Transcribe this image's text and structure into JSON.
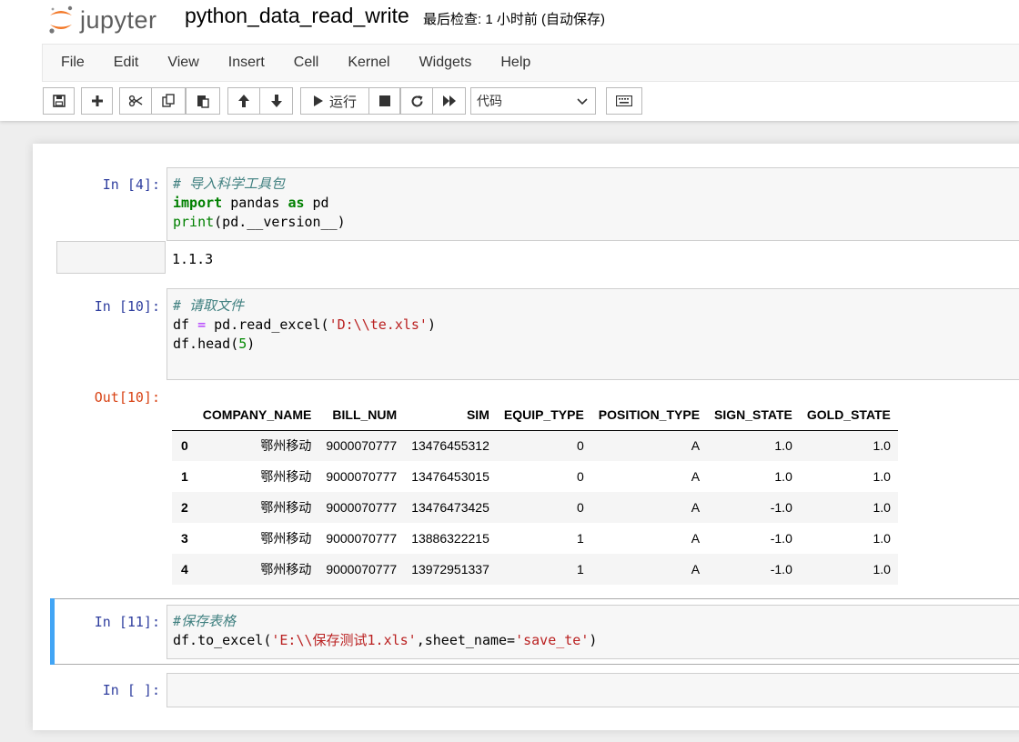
{
  "header": {
    "logo_text": "jupyter",
    "notebook_title": "python_data_read_write",
    "checkpoint": "最后检查: 1 小时前  (自动保存)"
  },
  "menu": [
    "File",
    "Edit",
    "View",
    "Insert",
    "Cell",
    "Kernel",
    "Widgets",
    "Help"
  ],
  "toolbar": {
    "run_label": "运行",
    "cell_type": "代码"
  },
  "cells": {
    "c1": {
      "prompt": "In  [4]:",
      "lines": [
        [
          {
            "t": "# 导入科学工具包",
            "c": "cm-comment"
          }
        ],
        [
          {
            "t": "import",
            "c": "cm-kw"
          },
          {
            "t": " pandas ",
            "c": ""
          },
          {
            "t": "as",
            "c": "cm-kw"
          },
          {
            "t": " pd",
            "c": ""
          }
        ],
        [
          {
            "t": "print",
            "c": "cm-builtin"
          },
          {
            "t": "(pd.__version__)",
            "c": ""
          }
        ]
      ],
      "output": "1.1.3"
    },
    "c2": {
      "prompt": "In  [10]:",
      "lines": [
        [
          {
            "t": "# 请取文件",
            "c": "cm-comment"
          }
        ],
        [
          {
            "t": "df ",
            "c": ""
          },
          {
            "t": "=",
            "c": "cm-op"
          },
          {
            "t": " pd.read_excel(",
            "c": ""
          },
          {
            "t": "'D:\\\\te.xls'",
            "c": "cm-str"
          },
          {
            "t": ")",
            "c": ""
          }
        ],
        [
          {
            "t": "df.head(",
            "c": ""
          },
          {
            "t": "5",
            "c": "cm-num"
          },
          {
            "t": ")",
            "c": ""
          }
        ]
      ],
      "out_prompt": "Out[10]:"
    },
    "c3": {
      "prompt": "In  [11]:",
      "lines": [
        [
          {
            "t": "#保存表格",
            "c": "cm-comment"
          }
        ],
        [
          {
            "t": "df.to_excel(",
            "c": ""
          },
          {
            "t": "'E:\\\\保存测试1.xls'",
            "c": "cm-str"
          },
          {
            "t": ",sheet_name=",
            "c": ""
          },
          {
            "t": "'save_te'",
            "c": "cm-str"
          },
          {
            "t": ")",
            "c": ""
          }
        ]
      ]
    },
    "c4": {
      "prompt": "In  [ ]:"
    }
  },
  "dataframe": {
    "columns": [
      "",
      "COMPANY_NAME",
      "BILL_NUM",
      "SIM",
      "EQUIP_TYPE",
      "POSITION_TYPE",
      "SIGN_STATE",
      "GOLD_STATE"
    ],
    "rows": [
      [
        "0",
        "鄂州移动",
        "9000070777",
        "13476455312",
        "0",
        "A",
        "1.0",
        "1.0"
      ],
      [
        "1",
        "鄂州移动",
        "9000070777",
        "13476453015",
        "0",
        "A",
        "1.0",
        "1.0"
      ],
      [
        "2",
        "鄂州移动",
        "9000070777",
        "13476473425",
        "0",
        "A",
        "-1.0",
        "1.0"
      ],
      [
        "3",
        "鄂州移动",
        "9000070777",
        "13886322215",
        "1",
        "A",
        "-1.0",
        "1.0"
      ],
      [
        "4",
        "鄂州移动",
        "9000070777",
        "13972951337",
        "1",
        "A",
        "-1.0",
        "1.0"
      ]
    ]
  }
}
